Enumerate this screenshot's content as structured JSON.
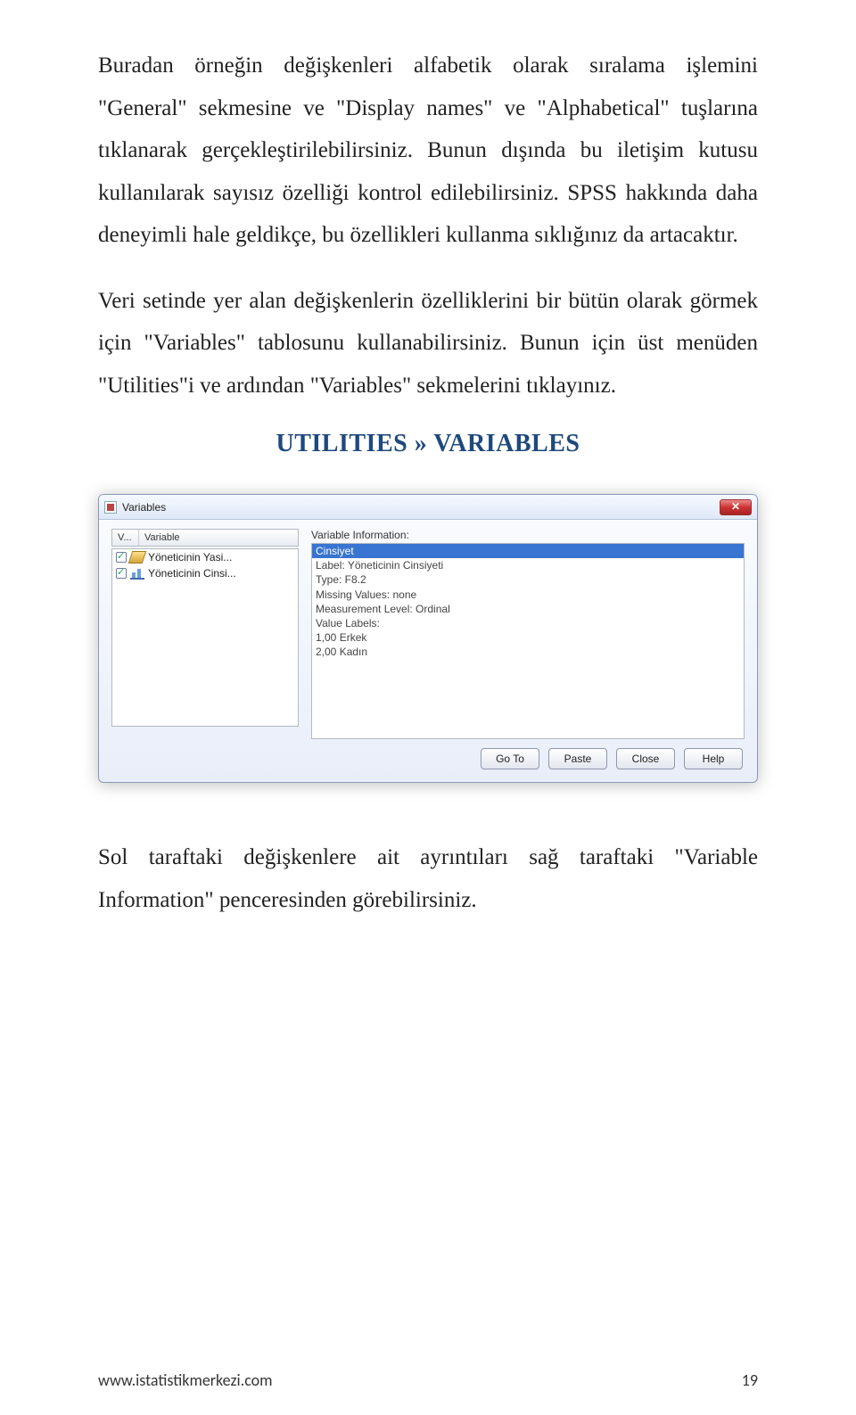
{
  "paragraphs": {
    "p1": "Buradan örneğin değişkenleri alfabetik olarak sıralama işlemini \"General\" sekmesine ve \"Display names\" ve \"Alphabetical\" tuşlarına tıklanarak gerçekleştirilebilirsiniz. Bunun dışında bu iletişim kutusu kullanılarak sayısız özelliği kontrol edilebilirsiniz. SPSS hakkında daha deneyimli hale geldikçe, bu özellikleri kullanma sıklığınız da artacaktır.",
    "p2": "Veri setinde yer alan değişkenlerin özelliklerini bir bütün olarak görmek için \"Variables\" tablosunu kullanabilirsiniz. Bunun için üst menüden \"Utilities\"i ve ardından \"Variables\" sekmelerini tıklayınız.",
    "p3": "Sol taraftaki değişkenlere ait ayrıntıları sağ taraftaki \"Variable Information\" penceresinden görebilirsiniz."
  },
  "navHeading": "UTILITIES  »  VARIABLES",
  "dialog": {
    "title": "Variables",
    "listHeader": {
      "col1": "V...",
      "col2": "Variable"
    },
    "rows": [
      {
        "name": "Yöneticinin Yasi..."
      },
      {
        "name": "Yöneticinin Cinsi..."
      }
    ],
    "infoCaption": "Variable Information:",
    "info": {
      "selected": "Cinsiyet",
      "lines": [
        "Label:  Yöneticinin Cinsiyeti",
        "Type:  F8.2",
        "Missing Values:  none",
        "Measurement Level:  Ordinal",
        "",
        "Value Labels:",
        "1,00 Erkek",
        "2,00 Kadın"
      ]
    },
    "buttons": {
      "goto": "Go To",
      "paste": "Paste",
      "close": "Close",
      "help": "Help"
    }
  },
  "footer": {
    "left": "www.istatistikmerkezi.com",
    "right": "19"
  }
}
